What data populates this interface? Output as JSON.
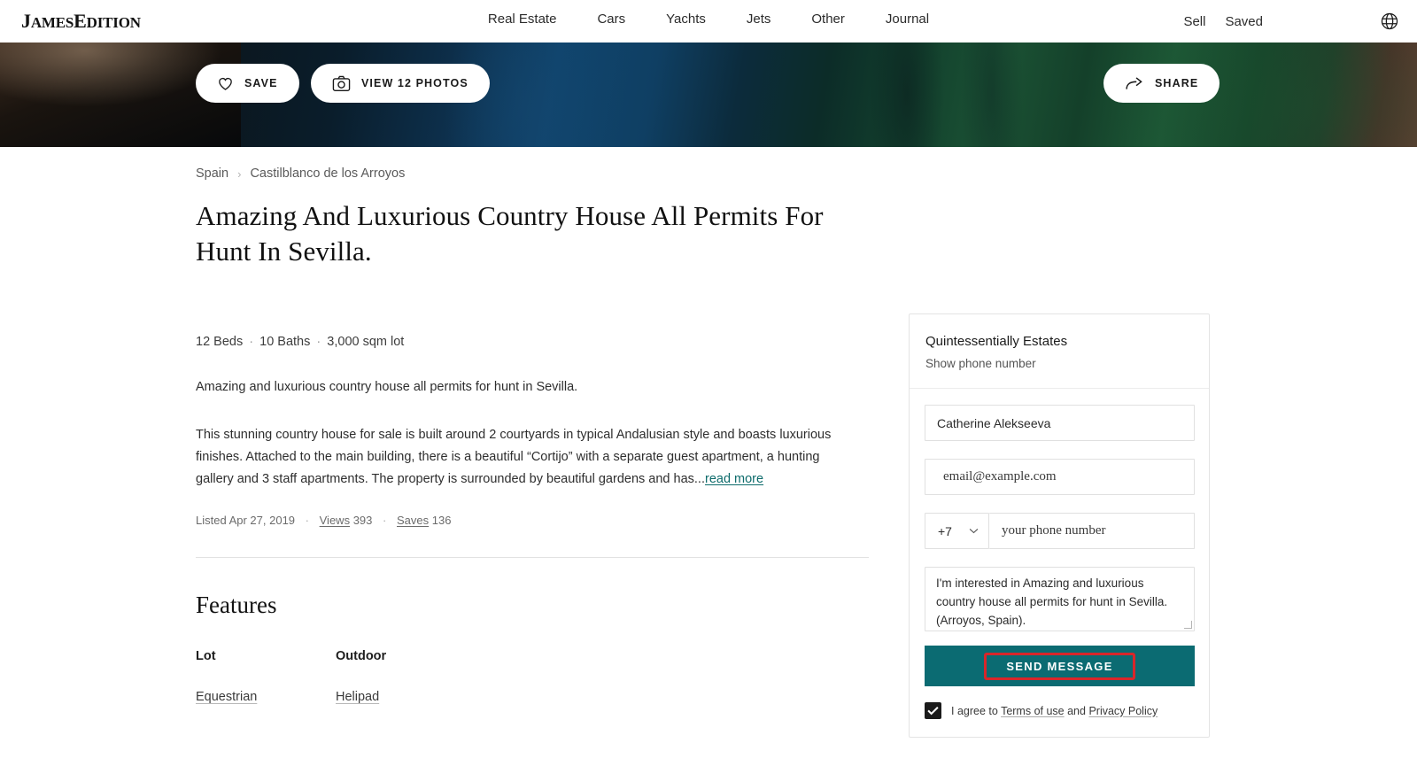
{
  "header": {
    "brand": "JamesEdition",
    "nav": [
      {
        "label": "Real Estate"
      },
      {
        "label": "Cars"
      },
      {
        "label": "Yachts"
      },
      {
        "label": "Jets"
      },
      {
        "label": "Other"
      },
      {
        "label": "Journal"
      }
    ],
    "sell_label": "Sell",
    "saved_label": "Saved",
    "globe_icon": "globe-icon"
  },
  "hero": {
    "save_label": "SAVE",
    "save_icon": "heart-icon",
    "photos_label": "VIEW 12 PHOTOS",
    "photos_icon": "camera-icon",
    "share_label": "SHARE",
    "share_icon": "share-arrow-icon"
  },
  "listing": {
    "breadcrumb": {
      "country": "Spain",
      "separator": "›",
      "city": "Castilblanco de los Arroyos"
    },
    "title": "Amazing And Luxurious Country House All Permits For Hunt In Sevilla.",
    "specs": {
      "beds": "12 Beds",
      "baths": "10 Baths",
      "lot": "3,000 sqm lot",
      "separator": "·"
    },
    "description_lead": "Amazing and luxurious country house all permits for hunt in Sevilla.",
    "description_body": "This stunning country house for sale is built around 2 courtyards in typical Andalusian style and boasts luxurious finishes.\nAttached to the main building, there is a beautiful “Cortijo” with a separate guest apartment, a hunting gallery and 3 staff apartments. The property is surrounded by beautiful gardens and has...",
    "read_more": "read more",
    "meta": {
      "listed": "Listed Apr 27, 2019",
      "views_label": "Views",
      "views_value": "393",
      "saves_label": "Saves",
      "saves_value": "136",
      "separator": "·"
    }
  },
  "features": {
    "title": "Features",
    "columns": [
      {
        "heading": "Lot",
        "items": [
          "Equestrian"
        ]
      },
      {
        "heading": "Outdoor",
        "items": [
          "Helipad"
        ]
      }
    ]
  },
  "contact": {
    "agency": "Quintessentially Estates",
    "show_phone": "Show phone number",
    "name_value": "Catherine Alekseeva",
    "email_placeholder": "email@example.com",
    "country_code": "+7",
    "country_code_icon": "chevron-down-icon",
    "phone_placeholder": "your phone number",
    "message_value": "I'm interested in Amazing and luxurious country house all permits for hunt in Sevilla. (Arroyos, Spain).",
    "send_label": "SEND MESSAGE",
    "agree_prefix": "I agree to ",
    "terms_link": "Terms of use",
    "agree_middle": " and ",
    "privacy_link": "Privacy Policy"
  },
  "colors": {
    "accent_teal": "#0b6b72",
    "highlight_red": "#d8262a",
    "link_teal": "#0d6b6b",
    "text_dark": "#1a1a1a"
  }
}
